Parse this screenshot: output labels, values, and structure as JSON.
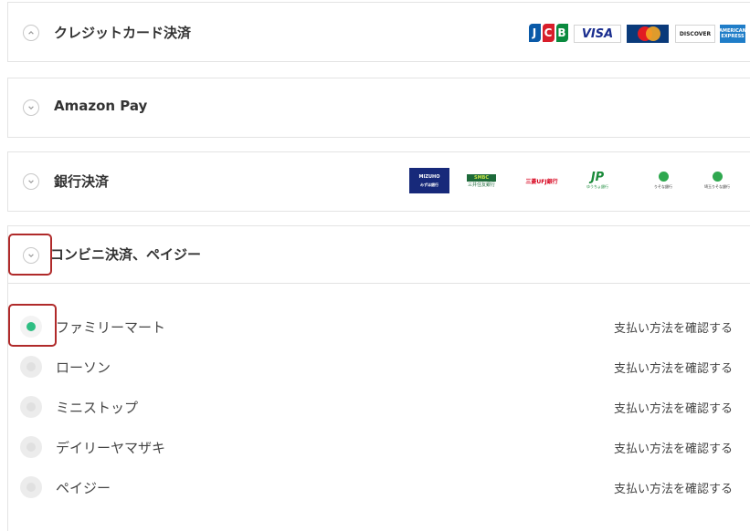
{
  "sections": {
    "credit": {
      "title": "クレジットカード決済",
      "expanded": true
    },
    "amazon": {
      "title": "Amazon Pay",
      "expanded": false
    },
    "bank": {
      "title": "銀行決済",
      "expanded": false
    },
    "konbini": {
      "title": "コンビニ決済、ペイジー",
      "expanded": false
    }
  },
  "card_logos": [
    {
      "name": "JCB",
      "letters": [
        "J",
        "C",
        "B"
      ],
      "colors": [
        "#0a5aa8",
        "#d81e2a",
        "#0a8a3e"
      ]
    },
    {
      "name": "VISA",
      "text": "VISA"
    },
    {
      "name": "MasterCard",
      "text": "MasterCard"
    },
    {
      "name": "DISCOVER",
      "text": "DISCOVER"
    },
    {
      "name": "AMERICAN EXPRESS",
      "text": "AMERICAN EXPRESS"
    }
  ],
  "bank_logos": [
    {
      "name": "MIZUHO",
      "text": "MIZUHO",
      "subtext": "みずほ銀行"
    },
    {
      "name": "SMBC",
      "text": "SMBC",
      "subtext": "三井住友銀行"
    },
    {
      "name": "三菱UFJ銀行",
      "text": "三菱UFJ銀行"
    },
    {
      "name": "JP BANK",
      "text": "JP",
      "subtext": "ゆうちょ銀行"
    },
    {
      "name": "りそな銀行",
      "text": "りそな銀行"
    },
    {
      "name": "埼玉りそな銀行",
      "text": "埼玉りそな銀行"
    }
  ],
  "konbini_options": [
    {
      "label": "ファミリーマート",
      "link": "支払い方法を確認する",
      "selected": true
    },
    {
      "label": "ローソン",
      "link": "支払い方法を確認する",
      "selected": false
    },
    {
      "label": "ミニストップ",
      "link": "支払い方法を確認する",
      "selected": false
    },
    {
      "label": "デイリーヤマザキ",
      "link": "支払い方法を確認する",
      "selected": false
    },
    {
      "label": "ペイジー",
      "link": "支払い方法を確認する",
      "selected": false
    }
  ],
  "colors": {
    "accent": "#2fbe83",
    "highlight": "#b02a2a",
    "border": "#e3e3e3"
  }
}
